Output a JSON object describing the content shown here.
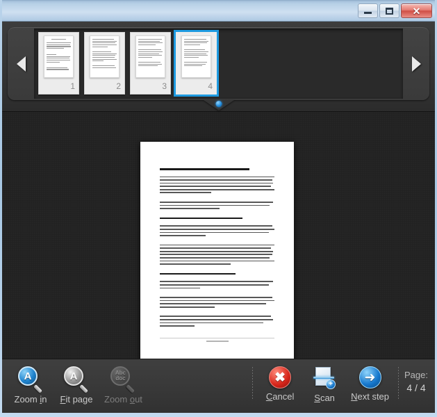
{
  "window": {
    "controls": {
      "minimize_label": "Minimize",
      "maximize_label": "Maximize",
      "close_label": "✕"
    }
  },
  "thumbnail_strip": {
    "prev_arrow": "◀",
    "next_arrow": "▶",
    "selected_index": 4,
    "thumbnails": [
      {
        "number": "1"
      },
      {
        "number": "2"
      },
      {
        "number": "3"
      },
      {
        "number": "4"
      }
    ]
  },
  "preview": {
    "page_number": 4
  },
  "toolbar": {
    "zoom_in": {
      "label": "Zoom in",
      "accel": "i",
      "icon": "magnifier-plus-icon",
      "glyph": "A",
      "enabled": true
    },
    "fit_page": {
      "label": "Fit page",
      "accel": "F",
      "icon": "magnifier-fit-icon",
      "glyph": "A",
      "enabled": true
    },
    "zoom_out": {
      "label": "Zoom out",
      "accel": "o",
      "icon": "magnifier-minus-icon",
      "glyph": "Abc doc",
      "enabled": false
    },
    "cancel": {
      "label": "Cancel",
      "accel": "C",
      "icon": "cancel-icon",
      "glyph": "✖"
    },
    "scan": {
      "label": "Scan",
      "accel": "S",
      "icon": "scanner-add-icon",
      "glyph": "+"
    },
    "next_step": {
      "label": "Next step",
      "accel": "N",
      "icon": "arrow-right-icon",
      "glyph": "➜"
    },
    "page_counter": {
      "label": "Page:",
      "value": "4 / 4",
      "current": 4,
      "total": 4
    }
  },
  "colors": {
    "accent_blue": "#1e9ae0",
    "cancel_red": "#d8271c",
    "panel_dark": "#222222",
    "toolbar_gray": "#3a3a3a",
    "titlebar_blue": "#b7d0e6"
  }
}
